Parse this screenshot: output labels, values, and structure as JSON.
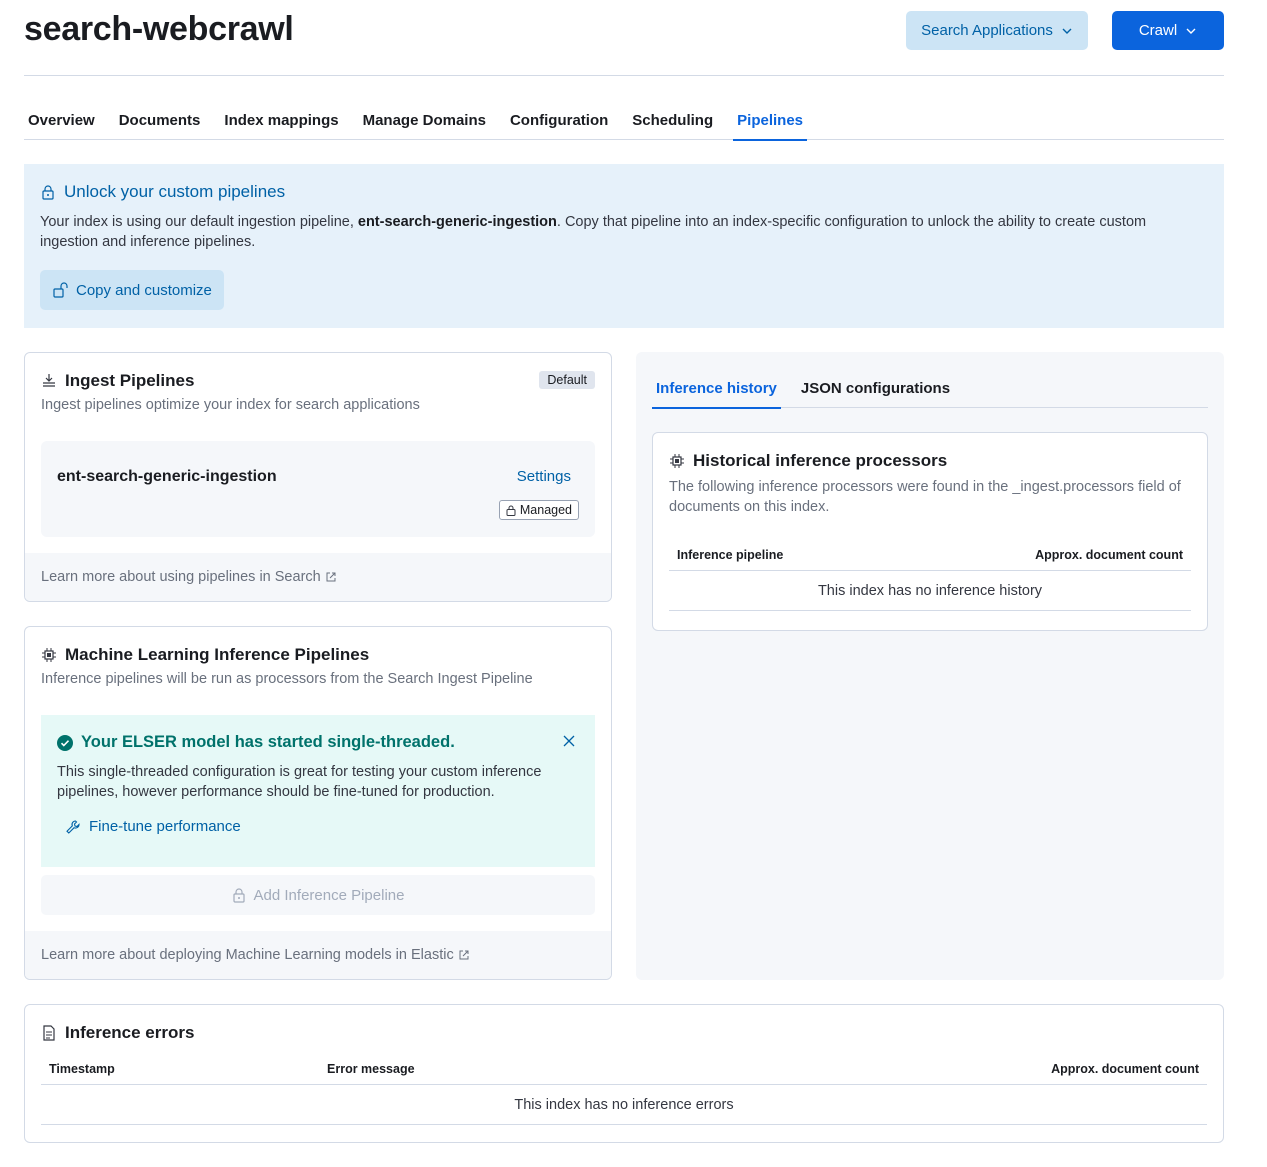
{
  "page_title": "search-webcrawl",
  "header_buttons": {
    "search_applications": "Search Applications",
    "crawl": "Crawl"
  },
  "tabs": [
    {
      "label": "Overview",
      "active": false
    },
    {
      "label": "Documents",
      "active": false
    },
    {
      "label": "Index mappings",
      "active": false
    },
    {
      "label": "Manage Domains",
      "active": false
    },
    {
      "label": "Configuration",
      "active": false
    },
    {
      "label": "Scheduling",
      "active": false
    },
    {
      "label": "Pipelines",
      "active": true
    }
  ],
  "unlock_callout": {
    "title": "Unlock your custom pipelines",
    "body_prefix": "Your index is using our default ingestion pipeline, ",
    "body_pipeline": "ent-search-generic-ingestion",
    "body_suffix": ". Copy that pipeline into an index-specific configuration to unlock the ability to create custom ingestion and inference pipelines.",
    "button": "Copy and customize"
  },
  "ingest_panel": {
    "title": "Ingest Pipelines",
    "badge": "Default",
    "subtitle": "Ingest pipelines optimize your index for search applications",
    "pipeline_name": "ent-search-generic-ingestion",
    "settings_link": "Settings",
    "managed_badge": "Managed",
    "footer_link": "Learn more about using pipelines in Search"
  },
  "ml_panel": {
    "title": "Machine Learning Inference Pipelines",
    "subtitle": "Inference pipelines will be run as processors from the Search Ingest Pipeline",
    "success_title": "Your ELSER model has started single-threaded.",
    "success_body": "This single-threaded configuration is great for testing your custom inference pipelines, however performance should be fine-tuned for production.",
    "finetune_link": "Fine-tune performance",
    "add_button": "Add Inference Pipeline",
    "footer_link": "Learn more about deploying Machine Learning models in Elastic"
  },
  "right_panel": {
    "tabs": [
      {
        "label": "Inference history",
        "active": true
      },
      {
        "label": "JSON configurations",
        "active": false
      }
    ],
    "history_title": "Historical inference processors",
    "history_subtitle": "The following inference processors were found in the _ingest.processors field of documents on this index.",
    "columns": [
      "Inference pipeline",
      "Approx. document count"
    ],
    "empty": "This index has no inference history"
  },
  "errors_panel": {
    "title": "Inference errors",
    "columns": [
      "Timestamp",
      "Error message",
      "Approx. document count"
    ],
    "empty": "This index has no inference errors"
  },
  "colors": {
    "primary": "#0b64dd",
    "link": "#0061a6",
    "success": "#00726b",
    "callout_bg": "#e6f1fa",
    "success_bg": "#e6f9f7"
  }
}
